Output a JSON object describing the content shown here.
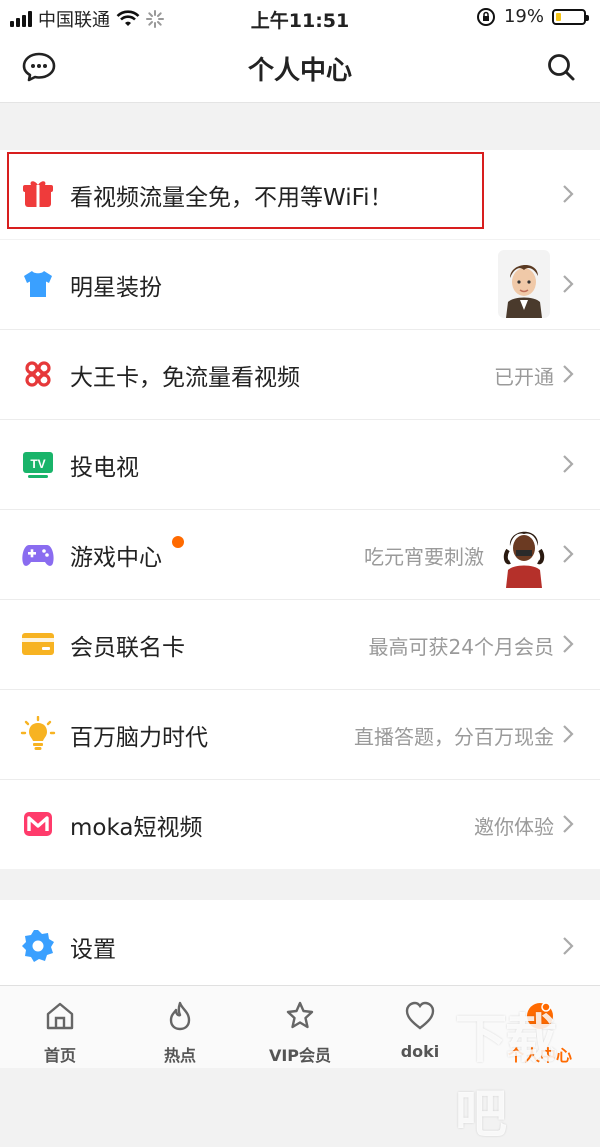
{
  "status_bar": {
    "carrier": "中国联通",
    "time": "上午11:51",
    "battery": "19%",
    "battery_level": 0.19
  },
  "header": {
    "title": "个人中心",
    "left_icon": "chat-bubble-icon",
    "right_icon": "search-icon"
  },
  "menu": {
    "promo": {
      "label": "看视频流量全免，不用等WiFi！"
    },
    "items": [
      {
        "label": "明星装扮",
        "sub": "",
        "icon": "tshirt-icon",
        "color": "#3aa0ff"
      },
      {
        "label": "大王卡，免流量看视频",
        "sub": "已开通",
        "icon": "unicom-knot-icon",
        "color": "#e6393a"
      },
      {
        "label": "投电视",
        "sub": "",
        "icon": "tv-icon",
        "color": "#19b46a"
      },
      {
        "label": "游戏中心",
        "sub": "吃元宵要刺激",
        "icon": "gamepad-icon",
        "color": "#8a6cf0"
      },
      {
        "label": "会员联名卡",
        "sub": "最高可获24个月会员",
        "icon": "card-icon",
        "color": "#f7b322"
      },
      {
        "label": "百万脑力时代",
        "sub": "直播答题，分百万现金",
        "icon": "lightbulb-icon",
        "color": "#f7b322"
      },
      {
        "label": "moka短视频",
        "sub": "邀你体验",
        "icon": "moka-logo-icon",
        "color": "#ff3b6b"
      }
    ],
    "settings": {
      "label": "设置",
      "icon": "gear-icon",
      "color": "#3aa0ff"
    }
  },
  "tabbar": {
    "tabs": [
      {
        "label": "首页",
        "icon": "home-icon"
      },
      {
        "label": "热点",
        "icon": "flame-icon"
      },
      {
        "label": "VIP会员",
        "icon": "vip-crown-icon"
      },
      {
        "label": "doki",
        "icon": "doki-heart-icon"
      },
      {
        "label": "个人中心",
        "icon": "profile-icon",
        "active": true
      }
    ]
  },
  "watermark": "下载吧"
}
